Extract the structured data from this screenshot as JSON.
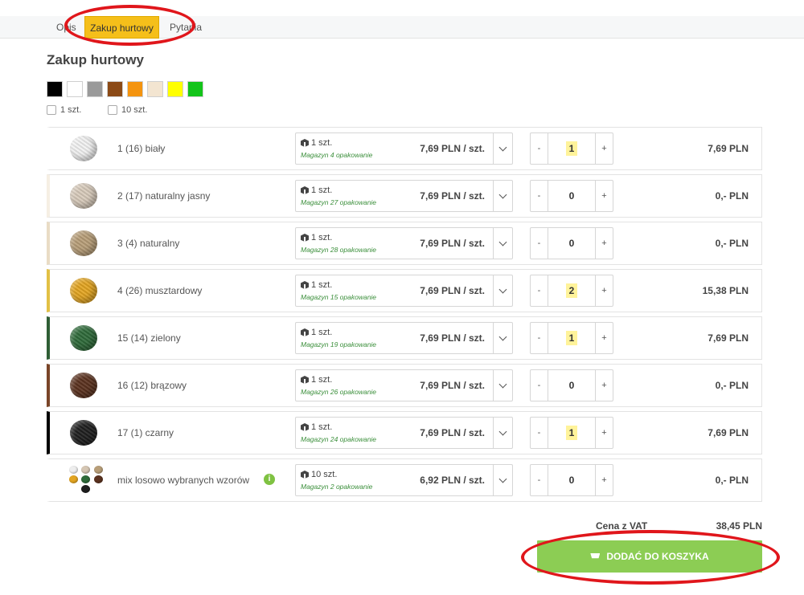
{
  "tabs": [
    {
      "label": "Opis"
    },
    {
      "label": "Zakup hurtowy"
    },
    {
      "label": "Pytania"
    }
  ],
  "heading": "Zakup hurtowy",
  "swatches": [
    "#000000",
    "#ffffff",
    "#9a9a9a",
    "#8b4a16",
    "#f4940f",
    "#f3e5d1",
    "#ffff00",
    "#13c41a"
  ],
  "packs": [
    "1 szt.",
    "10 szt."
  ],
  "rows": [
    {
      "name": "1 (16) biały",
      "unit": "1 szt.",
      "stock": "Magazyn 4 opakowanie",
      "price": "7,69 PLN / szt.",
      "minus": "-",
      "qty": "1",
      "plus": "+",
      "total": "7,69 PLN",
      "color": "#f2f2f2",
      "accent": "#ffffff"
    },
    {
      "name": "2 (17) naturalny jasny",
      "unit": "1 szt.",
      "stock": "Magazyn 27 opakowanie",
      "price": "7,69 PLN / szt.",
      "minus": "-",
      "qty": "0",
      "plus": "+",
      "total": "0,- PLN",
      "color": "#d8cbbb",
      "accent": "#f6efe4"
    },
    {
      "name": "3 (4) naturalny",
      "unit": "1 szt.",
      "stock": "Magazyn 28 opakowanie",
      "price": "7,69 PLN / szt.",
      "minus": "-",
      "qty": "0",
      "plus": "+",
      "total": "0,- PLN",
      "color": "#b89e78",
      "accent": "#e9dcc5"
    },
    {
      "name": "4 (26) musztardowy",
      "unit": "1 szt.",
      "stock": "Magazyn 15 opakowanie",
      "price": "7,69 PLN / szt.",
      "minus": "-",
      "qty": "2",
      "plus": "+",
      "total": "15,38 PLN",
      "color": "#e3a521",
      "accent": "#e2c045"
    },
    {
      "name": "15 (14) zielony",
      "unit": "1 szt.",
      "stock": "Magazyn 19 opakowanie",
      "price": "7,69 PLN / szt.",
      "minus": "-",
      "qty": "1",
      "plus": "+",
      "total": "7,69 PLN",
      "color": "#2f6b3a",
      "accent": "#2f5e35"
    },
    {
      "name": "16 (12) brązowy",
      "unit": "1 szt.",
      "stock": "Magazyn 26 opakowanie",
      "price": "7,69 PLN / szt.",
      "minus": "-",
      "qty": "0",
      "plus": "+",
      "total": "0,- PLN",
      "color": "#5b321f",
      "accent": "#7a4528"
    },
    {
      "name": "17 (1) czarny",
      "unit": "1 szt.",
      "stock": "Magazyn 24 opakowanie",
      "price": "7,69 PLN / szt.",
      "minus": "-",
      "qty": "1",
      "plus": "+",
      "total": "7,69 PLN",
      "color": "#1f1f1f",
      "accent": "#000000"
    },
    {
      "name": "mix losowo wybranych wzorów",
      "unit": "10 szt.",
      "stock": "Magazyn 2 opakowanie",
      "price": "6,92 PLN / szt.",
      "minus": "-",
      "qty": "0",
      "plus": "+",
      "total": "0,- PLN",
      "color": "mix",
      "accent": "transparent",
      "info": "i"
    }
  ],
  "mix_colors": [
    "#eeeeee",
    "#d5c6b3",
    "#b89e78",
    "#e3a521",
    "#2f6b3a",
    "#5b321f",
    "#1f1f1f"
  ],
  "summary": {
    "vat_label": "Cena z VAT",
    "vat_value": "38,45 PLN"
  },
  "add_button": "DODAĆ DO KOSZYKA",
  "highlight_color": "#e0161b"
}
